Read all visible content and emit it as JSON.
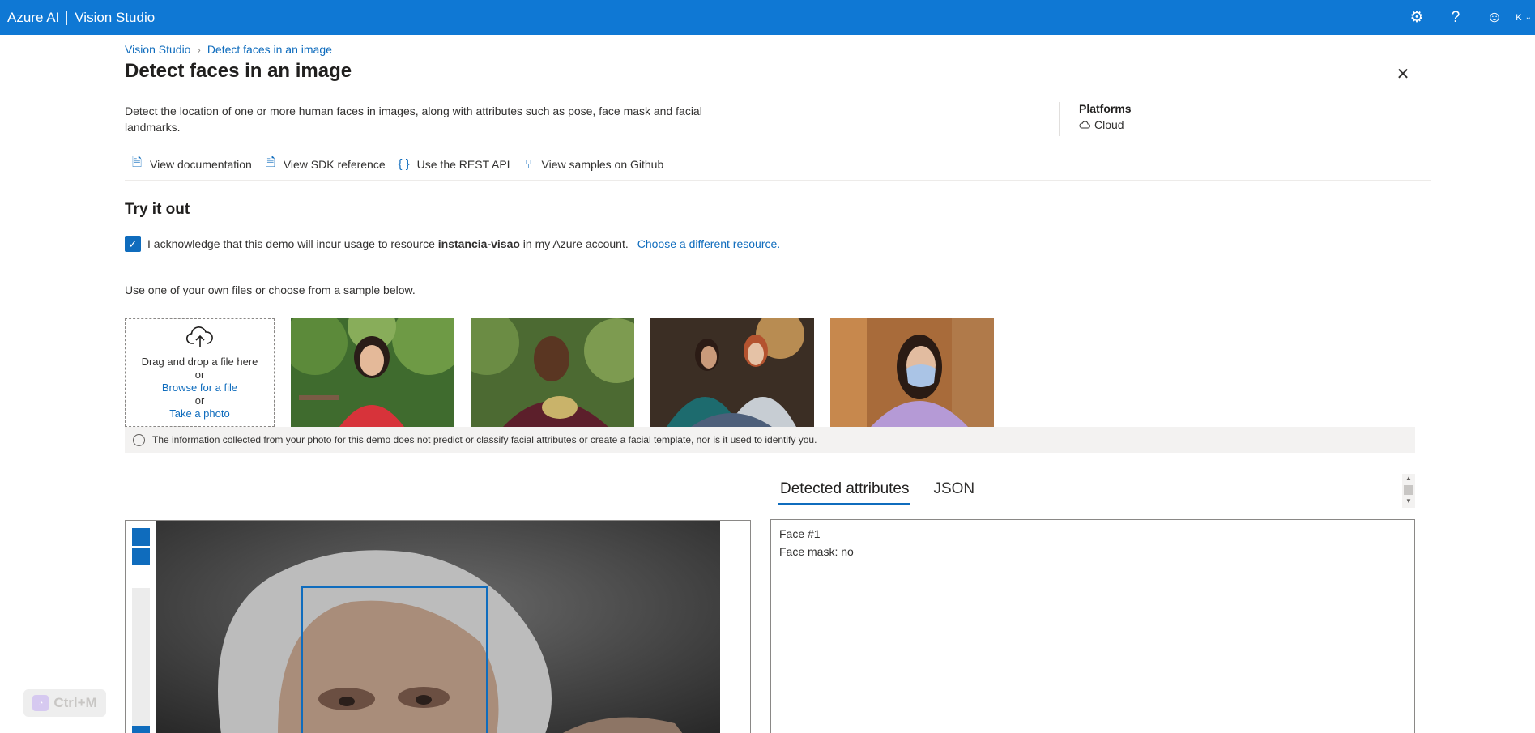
{
  "topbar": {
    "brand": "Azure AI",
    "product": "Vision Studio",
    "avatar_initial": "K"
  },
  "breadcrumb": {
    "root": "Vision Studio",
    "current": "Detect faces in an image"
  },
  "page": {
    "title": "Detect faces in an image",
    "description": "Detect the location of one or more human faces in images, along with attributes such as pose, face mask and facial landmarks."
  },
  "platforms": {
    "heading": "Platforms",
    "value": "Cloud"
  },
  "links": {
    "documentation": "View documentation",
    "sdk": "View SDK reference",
    "rest": "Use the REST API",
    "github": "View samples on Github"
  },
  "try_it": {
    "title": "Try it out",
    "ack_prefix": "I acknowledge that this demo will incur usage to resource",
    "resource": "instancia-visao",
    "ack_suffix": "in my Azure account.",
    "change_resource": "Choose a different resource.",
    "instructions": "Use one of your own files or choose from a sample below."
  },
  "dropzone": {
    "drag_text": "Drag and drop a file here",
    "or1": "or",
    "browse": "Browse for a file",
    "or2": "or",
    "photo": "Take a photo"
  },
  "info_notice": "The information collected from your photo for this demo does not predict or classify facial attributes or create a facial template, nor is it used to identify you.",
  "result_tabs": {
    "detected": "Detected attributes",
    "json": "JSON"
  },
  "results": {
    "face_label": "Face #1",
    "face_mask": "Face mask: no"
  },
  "overlay_shortcut": "Ctrl+M",
  "colors": {
    "accent": "#0f78d4",
    "link": "#0f6cbd",
    "info_bg": "#f3f2f1"
  }
}
